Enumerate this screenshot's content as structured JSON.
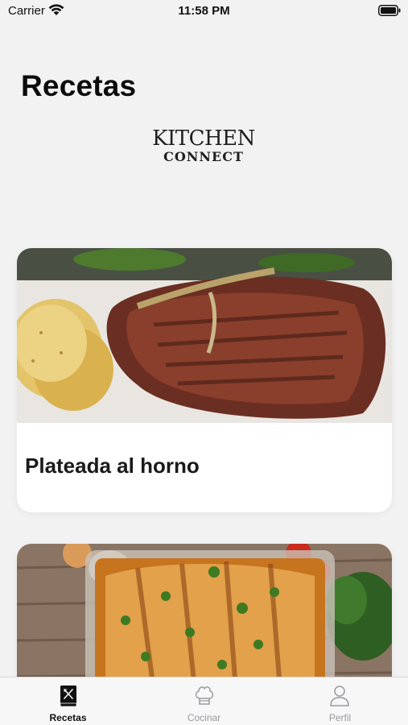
{
  "status_bar": {
    "carrier": "Carrier",
    "time": "11:58 PM"
  },
  "header": {
    "title": "Recetas",
    "logo_line1": "KITCHEN",
    "logo_line2": "CONNECT"
  },
  "recipes": [
    {
      "title": "Plateada al horno",
      "image": "grilled-steak-with-tortillas"
    },
    {
      "title": "",
      "image": "baked-lasagna-dish"
    }
  ],
  "tab_bar": {
    "tabs": [
      {
        "label": "Recetas",
        "icon": "recipe-book-icon",
        "active": true
      },
      {
        "label": "Cocinar",
        "icon": "chef-hat-icon",
        "active": false
      },
      {
        "label": "Perfil",
        "icon": "person-icon",
        "active": false
      }
    ]
  },
  "colors": {
    "background": "#f2f2f3",
    "card": "#ffffff",
    "active_tab": "#111111",
    "inactive_tab": "#9a9a9f"
  }
}
